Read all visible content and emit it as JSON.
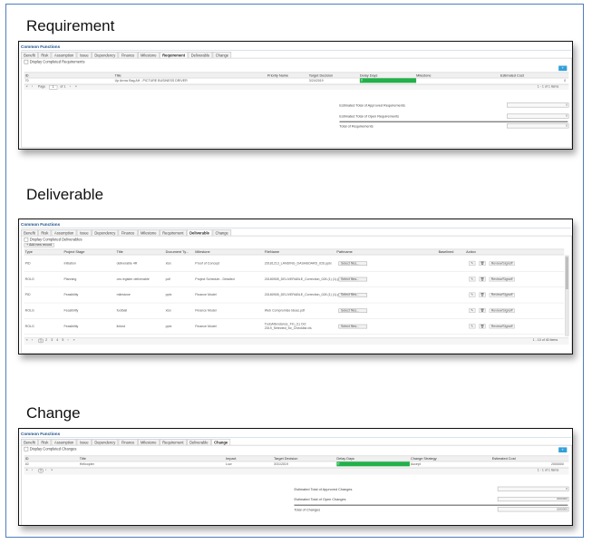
{
  "sections": {
    "requirement": "Requirement",
    "deliverable": "Deliverable",
    "change": "Change"
  },
  "common": {
    "title": "Common Functions",
    "tabs": [
      "Benefit",
      "Risk",
      "Assumption",
      "Issue",
      "Dependency",
      "Finance",
      "Milestone",
      "Requirement",
      "Deliverable",
      "Change"
    ]
  },
  "req": {
    "active_tab": "Requirement",
    "checkbox": "Display Completed Requirements",
    "add": "+",
    "columns": [
      "ID",
      "Title",
      "Priority Name",
      "Target Decision",
      "Delay Days",
      "Milestone",
      "Estimated Cost"
    ],
    "row": [
      "70",
      "Up Arrow Bag AH - PICTURE BUSINESS DRIVER",
      "",
      "3/24/2019",
      "0",
      "",
      "0"
    ],
    "pager_page": "Page",
    "pager_value": "1",
    "pager_of": "of 1",
    "pager_count": "1 - 1 of 1 items",
    "summary": [
      "Estimated Total of Approved Requirements",
      "Estimated Total of Open Requirements",
      "Total of Requirements"
    ],
    "summary_values": [
      "0",
      "0",
      "0"
    ]
  },
  "del": {
    "active_tab": "Deliverable",
    "checkbox": "Display Completed Deliverables",
    "add_record": "Add new record",
    "columns": [
      "Type",
      "Project Stage",
      "Title",
      "Document Ty...",
      "Milestone",
      "FileName",
      "Pathname",
      "Baselined",
      "Action"
    ],
    "rows": [
      [
        "PID",
        "Initiation",
        "deliverable 4R",
        "xlsx",
        "Proof of Concept",
        "20181213_LANDING_DASHBOARD_026.pptx"
      ],
      [
        "ROLG",
        "Planning",
        "ors register deliverable",
        "pdf",
        "Project Schedule - Detailed",
        "20180905_DELIVERABLE_Correction_028 (1) (1).pptx"
      ],
      [
        "PID",
        "Feasibility",
        "milestone",
        "pptx",
        "Finance Model",
        "20180905_DELIVERABLE_Correction_028 (1) (1).pptx"
      ],
      [
        "ROLG",
        "Feasibility",
        "football",
        "xlsx",
        "Finance Model",
        "Web Compromise Ideas.pdf"
      ],
      [
        "ROLG",
        "Feasibility",
        "linked",
        "pptx",
        "Finance Model",
        "TodoAttendance_Fin_(1) Oct 2019_Selected_for_Checklist.xls"
      ]
    ],
    "select_files": "Select files...",
    "action_label": "Review/Signoff",
    "pager_pages": [
      "1",
      "2",
      "3",
      "4",
      "5"
    ],
    "pager_count": "1 - 10 of 40 items"
  },
  "chg": {
    "active_tab": "Change",
    "checkbox": "Display Completed Changes",
    "add": "+",
    "columns": [
      "ID",
      "Title",
      "Impact",
      "Target Decision",
      "Delay Days",
      "Change Strategy",
      "Estimated Cost"
    ],
    "row": [
      "40",
      "Helicopter",
      "Low",
      "3/31/2019",
      "0",
      "Accept",
      "2000000"
    ],
    "pager_page": "1",
    "pager_count": "1 - 1 of 1 items",
    "summary": [
      "Estimated Total of Approved Changes",
      "Estimated Total of Open Changes",
      "Total of Changes"
    ],
    "summary_values": [
      "0",
      "2000000",
      "2000000"
    ]
  },
  "colors": {
    "frame_border": "#4f7ec0",
    "accent_green": "#22b04a",
    "accent_blue": "#33a0d8"
  }
}
